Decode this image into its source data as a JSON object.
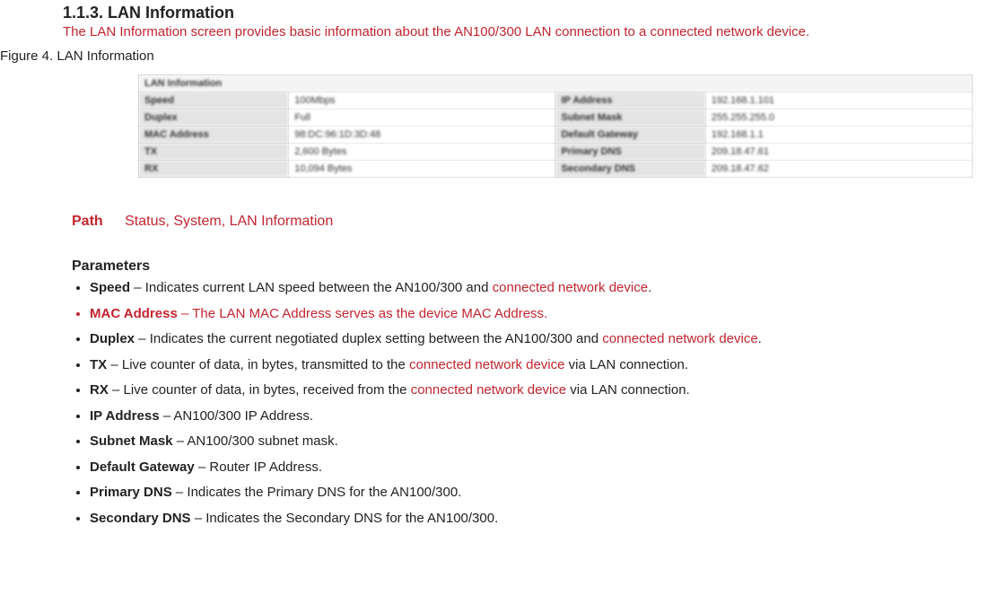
{
  "heading": "1.1.3. LAN Information",
  "summary": "The LAN Information screen provides basic information about the AN100/300 LAN connection to a connected network device.",
  "figureCaption": "Figure 4. LAN Information",
  "screenshot": {
    "title": "LAN Information",
    "rows": [
      {
        "l1": "Speed",
        "v1": "100Mbps",
        "l2": "IP Address",
        "v2": "192.168.1.101"
      },
      {
        "l1": "Duplex",
        "v1": "Full",
        "l2": "Subnet Mask",
        "v2": "255.255.255.0"
      },
      {
        "l1": "MAC Address",
        "v1": "98:DC:96:1D:3D:48",
        "l2": "Default Gateway",
        "v2": "192.168.1.1"
      },
      {
        "l1": "TX",
        "v1": "2,600 Bytes",
        "l2": "Primary DNS",
        "v2": "209.18.47.61"
      },
      {
        "l1": "RX",
        "v1": "10,094 Bytes",
        "l2": "Secondary DNS",
        "v2": "209.18.47.62"
      }
    ]
  },
  "path": {
    "label": "Path",
    "value": "Status, System, LAN Information"
  },
  "paramsHeading": "Parameters",
  "bullet": "•",
  "params": {
    "speed": {
      "name": "Speed",
      "pre": " – Indicates current LAN speed between the AN100/300 and ",
      "red": "connected network device",
      "post": "."
    },
    "mac": {
      "name": "MAC Address",
      "rest": " – The LAN MAC Address serves as the device MAC Address."
    },
    "duplex": {
      "name": "Duplex",
      "pre": " – Indicates the current negotiated duplex setting between the AN100/300 and ",
      "red": "connected network device",
      "post": "."
    },
    "tx": {
      "name": "TX",
      "pre": " – Live counter of data, in bytes, transmitted to the ",
      "red": "connected network device",
      "post": " via LAN connection."
    },
    "rx": {
      "name": "RX",
      "pre": " – Live counter of data, in bytes, received from the ",
      "red": "connected network device",
      "post": " via LAN connection."
    },
    "ip": {
      "name": "IP Address",
      "rest": " – AN100/300 IP Address."
    },
    "subnet": {
      "name": "Subnet Mask",
      "rest": " – AN100/300 subnet mask."
    },
    "gateway": {
      "name": "Default Gateway",
      "rest": " – Router IP Address."
    },
    "pdns": {
      "name": "Primary DNS",
      "rest": " – Indicates the Primary DNS for the AN100/300."
    },
    "sdns": {
      "name": "Secondary DNS",
      "rest": " – Indicates the Secondary DNS for the AN100/300."
    }
  }
}
